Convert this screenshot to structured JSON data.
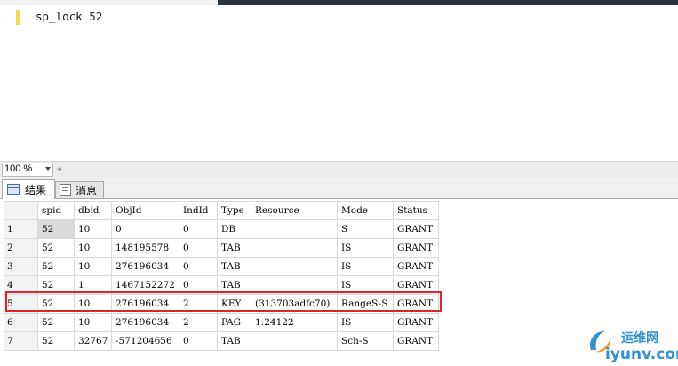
{
  "editor": {
    "keyword": "sp_lock",
    "argument": "52"
  },
  "zoom": {
    "value": "100 %"
  },
  "results_tabs": [
    {
      "label": "结果"
    },
    {
      "label": "消息"
    }
  ],
  "grid": {
    "columns": [
      "spid",
      "dbid",
      "ObjId",
      "IndId",
      "Type",
      "Resource",
      "Mode",
      "Status"
    ],
    "rows": [
      {
        "num": "1",
        "cells": [
          "52",
          "10",
          "0",
          "0",
          "DB",
          "",
          "S",
          "GRANT"
        ]
      },
      {
        "num": "2",
        "cells": [
          "52",
          "10",
          "148195578",
          "0",
          "TAB",
          "",
          "IS",
          "GRANT"
        ]
      },
      {
        "num": "3",
        "cells": [
          "52",
          "10",
          "276196034",
          "0",
          "TAB",
          "",
          "IS",
          "GRANT"
        ]
      },
      {
        "num": "4",
        "cells": [
          "52",
          "1",
          "1467152272",
          "0",
          "TAB",
          "",
          "IS",
          "GRANT"
        ]
      },
      {
        "num": "5",
        "cells": [
          "52",
          "10",
          "276196034",
          "2",
          "KEY",
          "(313703adfc70)",
          "RangeS-S",
          "GRANT"
        ]
      },
      {
        "num": "6",
        "cells": [
          "52",
          "10",
          "276196034",
          "2",
          "PAG",
          "1:24122",
          "IS",
          "GRANT"
        ]
      },
      {
        "num": "7",
        "cells": [
          "52",
          "32767",
          "-571204656",
          "0",
          "TAB",
          "",
          "Sch-S",
          "GRANT"
        ]
      }
    ]
  },
  "watermark": {
    "cn": "运维网",
    "en": "iyunv.com"
  },
  "colors": {
    "highlight": "#e0242a",
    "watermark": "#2f8fd0"
  }
}
